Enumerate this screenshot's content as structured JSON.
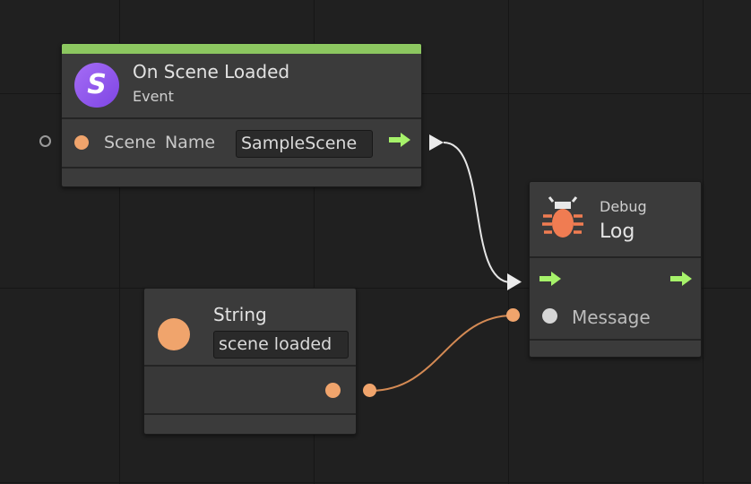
{
  "accent_colors": {
    "event_header": "#8cc760",
    "flow_arrow": "#a6f26a",
    "string_port": "#f0a46c",
    "bug": "#f07c52",
    "event_icon": "#9b5cf0"
  },
  "event_node": {
    "icon": "s-circle-icon",
    "icon_letter": "S",
    "title": "On Scene Loaded",
    "subtitle": "Event",
    "param_label": "Scene Name",
    "param_value": "SampleScene"
  },
  "debug_node": {
    "icon": "bug-icon",
    "category": "Debug",
    "title": "Log",
    "input_label": "Message"
  },
  "string_node": {
    "icon": "orange-circle-icon",
    "title": "String",
    "value": "scene loaded"
  }
}
